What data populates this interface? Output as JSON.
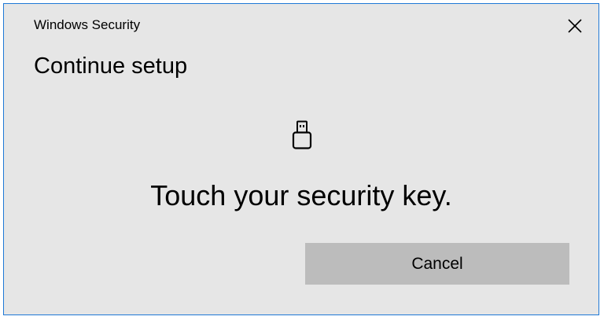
{
  "window": {
    "app_title": "Windows Security",
    "close_icon": "close-icon"
  },
  "dialog": {
    "heading": "Continue setup",
    "icon": "usb-security-key-icon",
    "message": "Touch your security key.",
    "cancel_label": "Cancel"
  },
  "colors": {
    "background": "#e6e6e6",
    "border": "#1f78d6",
    "button": "#bcbcbc"
  }
}
